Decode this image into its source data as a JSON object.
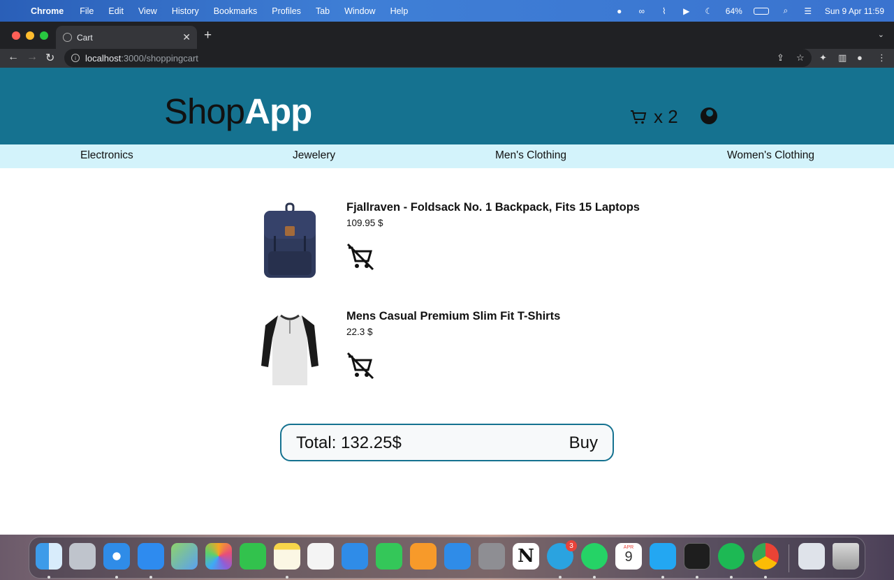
{
  "menubar": {
    "app": "Chrome",
    "items": [
      "File",
      "Edit",
      "View",
      "History",
      "Bookmarks",
      "Profiles",
      "Tab",
      "Window",
      "Help"
    ],
    "battery": "64%",
    "datetime": "Sun 9 Apr  11:59"
  },
  "browser": {
    "tab_title": "Cart",
    "url_host": "localhost",
    "url_path": ":3000/shoppingcart"
  },
  "shop": {
    "logo_part1": "Shop",
    "logo_part2": "App",
    "cart_count": "x 2",
    "categories": [
      "Electronics",
      "Jewelery",
      "Men's Clothing",
      "Women's Clothing"
    ]
  },
  "cart": {
    "items": [
      {
        "title": "Fjallraven - Foldsack No. 1 Backpack, Fits 15 Laptops",
        "price": "109.95 $"
      },
      {
        "title": "Mens Casual Premium Slim Fit T-Shirts",
        "price": "22.3 $"
      }
    ],
    "total": "Total: 132.25$",
    "buy_label": "Buy"
  },
  "dock": {
    "apps": [
      "Finder",
      "Launchpad",
      "Safari",
      "Mail",
      "Maps",
      "Photos",
      "FaceTime",
      "Notes",
      "Freeform",
      "Keynote",
      "Numbers",
      "Pages",
      "App Store",
      "System Settings",
      "Notion",
      "Telegram",
      "WhatsApp",
      "Calendar",
      "VS Code",
      "Terminal",
      "Spotify",
      "Chrome",
      "Downloads",
      "Trash"
    ],
    "telegram_badge": "3",
    "calendar_month": "APR",
    "calendar_day": "9"
  }
}
